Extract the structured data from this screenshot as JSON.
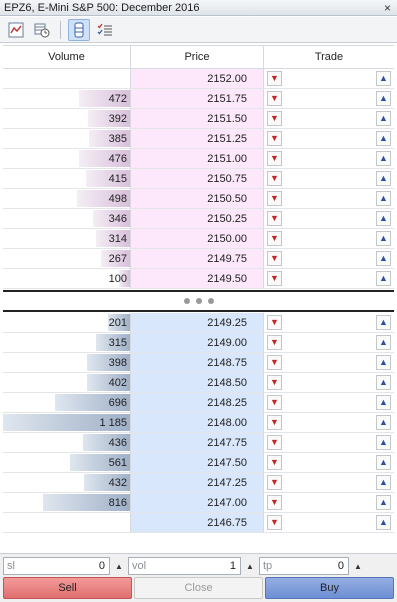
{
  "window": {
    "title": "EPZ6, E-Mini S&P 500: December 2016",
    "close_glyph": "×"
  },
  "toolbar": {
    "icons": [
      "chart-icon",
      "table-clock-icon",
      "order-book-icon",
      "checklist-icon"
    ],
    "active_index": 2
  },
  "columns": {
    "volume": "Volume",
    "price": "Price",
    "trade": "Trade"
  },
  "max_volume": 1185,
  "asks": [
    {
      "volume": "",
      "vol_n": 0,
      "price": "2152.00"
    },
    {
      "volume": "472",
      "vol_n": 472,
      "price": "2151.75"
    },
    {
      "volume": "392",
      "vol_n": 392,
      "price": "2151.50"
    },
    {
      "volume": "385",
      "vol_n": 385,
      "price": "2151.25"
    },
    {
      "volume": "476",
      "vol_n": 476,
      "price": "2151.00"
    },
    {
      "volume": "415",
      "vol_n": 415,
      "price": "2150.75"
    },
    {
      "volume": "498",
      "vol_n": 498,
      "price": "2150.50"
    },
    {
      "volume": "346",
      "vol_n": 346,
      "price": "2150.25"
    },
    {
      "volume": "314",
      "vol_n": 314,
      "price": "2150.00"
    },
    {
      "volume": "267",
      "vol_n": 267,
      "price": "2149.75"
    },
    {
      "volume": "100",
      "vol_n": 100,
      "price": "2149.50"
    }
  ],
  "bids": [
    {
      "volume": "201",
      "vol_n": 201,
      "price": "2149.25"
    },
    {
      "volume": "315",
      "vol_n": 315,
      "price": "2149.00"
    },
    {
      "volume": "398",
      "vol_n": 398,
      "price": "2148.75"
    },
    {
      "volume": "402",
      "vol_n": 402,
      "price": "2148.50"
    },
    {
      "volume": "696",
      "vol_n": 696,
      "price": "2148.25"
    },
    {
      "volume": "1 185",
      "vol_n": 1185,
      "price": "2148.00"
    },
    {
      "volume": "436",
      "vol_n": 436,
      "price": "2147.75"
    },
    {
      "volume": "561",
      "vol_n": 561,
      "price": "2147.50"
    },
    {
      "volume": "432",
      "vol_n": 432,
      "price": "2147.25"
    },
    {
      "volume": "816",
      "vol_n": 816,
      "price": "2147.00"
    },
    {
      "volume": "",
      "vol_n": 0,
      "price": "2146.75"
    }
  ],
  "inputs": {
    "sl": {
      "label": "sl",
      "value": "0"
    },
    "vol": {
      "label": "vol",
      "value": "1"
    },
    "tp": {
      "label": "tp",
      "value": "0"
    }
  },
  "actions": {
    "sell": "Sell",
    "close": "Close",
    "buy": "Buy"
  },
  "colors": {
    "sell": "#e06f6f",
    "buy": "#6d8fd4",
    "ask_bg": "#fde8fb",
    "bid_bg": "#d8e7fb"
  }
}
